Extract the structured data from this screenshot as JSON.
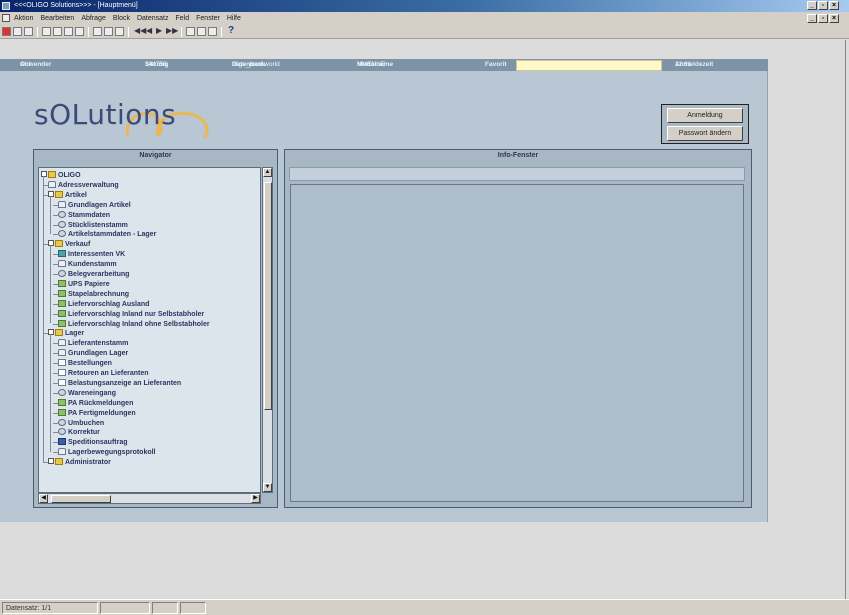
{
  "window": {
    "title": "<<<OLIGO Solutions>>> - [Hauptmenü]"
  },
  "menubar": {
    "items": [
      "Aktion",
      "Bearbeiten",
      "Abfrage",
      "Block",
      "Datensatz",
      "Feld",
      "Fenster",
      "Hilfe"
    ]
  },
  "info": {
    "anwender_label": "Anwender",
    "anwender_value": "OLI",
    "sitzung_label": "Sitzung",
    "sitzung_value": "144758",
    "datenbank_label": "Datenbank",
    "datenbank_value": "oligo_prod.world",
    "modulname_label": "Modulname",
    "modulname_value": "HMENUE",
    "favorit_label": "Favorit",
    "favorit_value": "",
    "anmeldezeit_label": "Anmeldezeit",
    "anmeldezeit_value": "12:31"
  },
  "logo": {
    "text": "sOLutions",
    "swoosh_color": "#f2b441",
    "text_color": "#3b4a78"
  },
  "buttons": {
    "anmeldung": "Anmeldung",
    "passwort": "Passwort ändern"
  },
  "navigator": {
    "title": "Navigator",
    "items": [
      {
        "label": "OLIGO",
        "icon": "folder-icon",
        "level": 0,
        "expander": true
      },
      {
        "label": "Adressverwaltung",
        "icon": "person-icon",
        "level": 1
      },
      {
        "label": "Artikel",
        "icon": "folder-icon",
        "level": 1,
        "expander": true
      },
      {
        "label": "Grundlagen Artikel",
        "icon": "person-icon",
        "level": 2
      },
      {
        "label": "Stammdaten",
        "icon": "gear-icon",
        "level": 2
      },
      {
        "label": "Stücklistenstamm",
        "icon": "gear-icon",
        "level": 2
      },
      {
        "label": "Artikelstammdaten - Lager",
        "icon": "gear-icon",
        "level": 2
      },
      {
        "label": "Verkauf",
        "icon": "folder-icon",
        "level": 1,
        "expander": true
      },
      {
        "label": "Interessenten VK",
        "icon": "teal-icon",
        "level": 2
      },
      {
        "label": "Kundenstamm",
        "icon": "person-icon",
        "level": 2
      },
      {
        "label": "Belegverarbeitung",
        "icon": "gear-icon",
        "level": 2
      },
      {
        "label": "UPS Papiere",
        "icon": "green-icon",
        "level": 2
      },
      {
        "label": "Stapelabrechnung",
        "icon": "green-icon",
        "level": 2
      },
      {
        "label": "Liefervorschlag Ausland",
        "icon": "green-icon",
        "level": 2
      },
      {
        "label": "Liefervorschlag Inland nur Selbstabholer",
        "icon": "green-icon",
        "level": 2
      },
      {
        "label": "Liefervorschlag Inland ohne Selbstabholer",
        "icon": "green-icon",
        "level": 2
      },
      {
        "label": "Lager",
        "icon": "folder-icon",
        "level": 1,
        "expander": true
      },
      {
        "label": "Lieferantenstamm",
        "icon": "person-icon",
        "level": 2
      },
      {
        "label": "Grundlagen Lager",
        "icon": "person-icon",
        "level": 2
      },
      {
        "label": "Bestellungen",
        "icon": "doc-icon",
        "level": 2
      },
      {
        "label": "Retouren an Lieferanten",
        "icon": "doc-icon",
        "level": 2
      },
      {
        "label": "Belastungsanzeige an Lieferanten",
        "icon": "doc-icon",
        "level": 2
      },
      {
        "label": "Wareneingang",
        "icon": "gear-icon",
        "level": 2
      },
      {
        "label": "PA Rückmeldungen",
        "icon": "green-icon",
        "level": 2
      },
      {
        "label": "PA Fertigmeldungen",
        "icon": "green-icon",
        "level": 2
      },
      {
        "label": "Umbuchen",
        "icon": "gear-icon",
        "level": 2
      },
      {
        "label": "Korrektur",
        "icon": "gear-icon",
        "level": 2
      },
      {
        "label": "Speditionsauftrag",
        "icon": "blue-icon",
        "level": 2
      },
      {
        "label": "Lagerbewegungsprotokoll",
        "icon": "person-icon",
        "level": 2
      },
      {
        "label": "Administrator",
        "icon": "folder-icon",
        "level": 1,
        "expander": true
      }
    ]
  },
  "infofenster": {
    "title": "Info-Fenster"
  },
  "statusbar": {
    "datensatz": "Datensatz: 1/1"
  }
}
